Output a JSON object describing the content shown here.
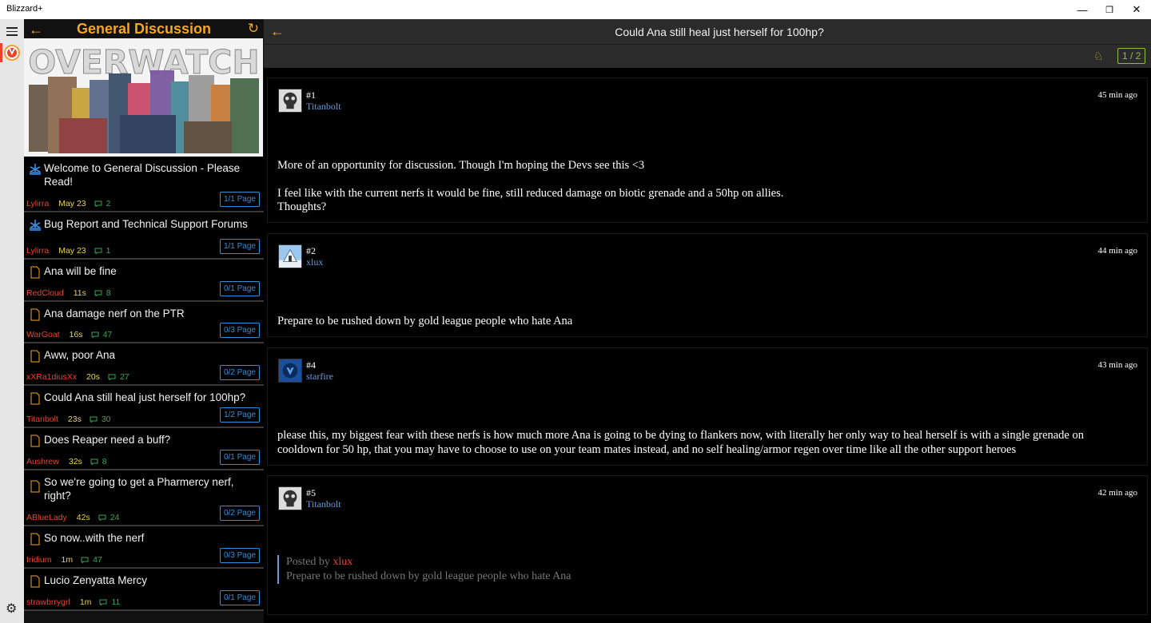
{
  "window": {
    "title": "Blizzard+",
    "minimize": "—",
    "restore": "❐",
    "close": "✕"
  },
  "nav": {
    "menu_icon": "hamburger-icon",
    "game_icon": "overwatch-logo-icon",
    "settings_icon": "gear-icon",
    "accent_color": "#e9432b"
  },
  "forum": {
    "title": "General Discussion",
    "back_glyph": "←",
    "refresh_glyph": "↻",
    "banner_text": "OVERWATCH",
    "threads": [
      {
        "title": "Welcome to General Discussion - Please Read!",
        "author": "Lylirra",
        "time": "May 23",
        "replies": "2",
        "page": "1/1 Page",
        "icon": "blizzard-icon"
      },
      {
        "title": "Bug Report and Technical Support Forums",
        "author": "Lylirra",
        "time": "May 23",
        "replies": "1",
        "page": "1/1 Page",
        "icon": "blizzard-icon"
      },
      {
        "title": "Ana will be fine",
        "author": "RedCloud",
        "time": "11s",
        "replies": "8",
        "page": "0/1 Page",
        "icon": "document-icon"
      },
      {
        "title": "Ana damage nerf on the PTR",
        "author": "WarGoat",
        "time": "16s",
        "replies": "47",
        "page": "0/3 Page",
        "icon": "document-icon"
      },
      {
        "title": "Aww, poor Ana",
        "author": "xXRa1diusXx",
        "time": "20s",
        "replies": "27",
        "page": "0/2 Page",
        "icon": "document-icon"
      },
      {
        "title": "Could Ana still heal just herself for 100hp?",
        "author": "Titanbolt",
        "time": "23s",
        "replies": "30",
        "page": "1/2 Page",
        "icon": "document-icon"
      },
      {
        "title": "Does Reaper need a buff?",
        "author": "Aushrew",
        "time": "32s",
        "replies": "8",
        "page": "0/1 Page",
        "icon": "document-icon"
      },
      {
        "title": "So we're going to get a Pharmercy nerf, right?",
        "author": "ABlueLady",
        "time": "42s",
        "replies": "24",
        "page": "0/2 Page",
        "icon": "document-icon"
      },
      {
        "title": "So now..with the nerf",
        "author": "Iridium",
        "time": "1m",
        "replies": "47",
        "page": "0/3 Page",
        "icon": "document-icon"
      },
      {
        "title": "Lucio Zenyatta Mercy",
        "author": "strawbrrygrl",
        "time": "1m",
        "replies": "11",
        "page": "0/1 Page",
        "icon": "document-icon"
      }
    ]
  },
  "topic": {
    "title": "Could Ana still heal just herself for 100hp?",
    "back_glyph": "←",
    "notify_icon": "bell-icon",
    "page_indicator": "1 / 2",
    "posts": [
      {
        "num": "#1",
        "user": "Titanbolt",
        "ago": "45 min ago",
        "avatar": "skull-avatar",
        "paragraphs": [
          "More of an opportunity for discussion. Though I'm hoping the Devs see this <3",
          "I feel like with the current nerfs it would be fine, still reduced damage on biotic grenade and a 50hp on allies.\nThoughts?"
        ]
      },
      {
        "num": "#2",
        "user": "xlux",
        "ago": "44 min ago",
        "avatar": "landscape-avatar",
        "paragraphs": [
          "Prepare to be rushed down by gold league people who hate Ana"
        ]
      },
      {
        "num": "#4",
        "user": "starfire",
        "ago": "43 min ago",
        "avatar": "blue-emblem-avatar",
        "paragraphs": [
          "please this, my biggest fear with these nerfs is how much more Ana is going to be dying to flankers now, with literally her only way to heal herself is with a single grenade on cooldown for 50 hp, that you may have to choose to use on your team mates instead, and no self healing/armor regen over time like all the other support heroes"
        ]
      },
      {
        "num": "#5",
        "user": "Titanbolt",
        "ago": "42 min ago",
        "avatar": "skull-avatar",
        "quote": {
          "prefix": "Posted by",
          "author": "xlux",
          "text": "Prepare to be rushed down by gold league people who hate Ana"
        }
      }
    ]
  }
}
